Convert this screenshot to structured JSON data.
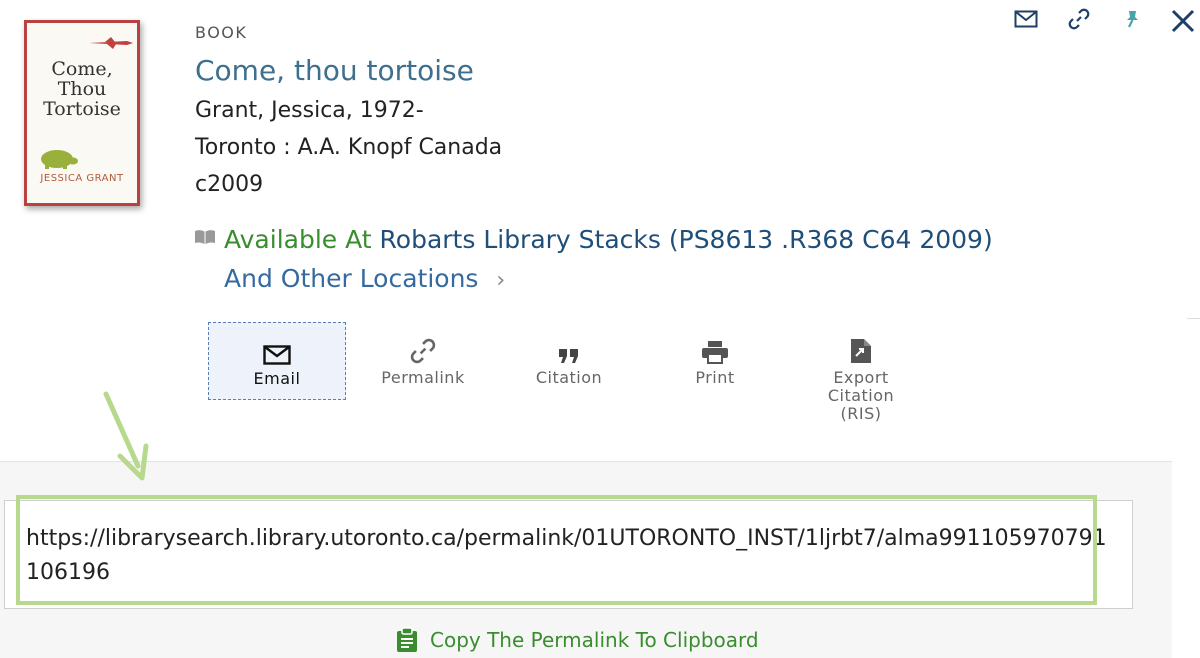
{
  "record": {
    "type": "BOOK",
    "title": "Come, thou tortoise",
    "author": "Grant, Jessica, 1972-",
    "publisher": "Toronto : A.A. Knopf Canada",
    "date": "c2009"
  },
  "cover": {
    "line1": "Come,",
    "line2": "Thou",
    "line3": "Tortoise",
    "author": "JESSICA GRANT"
  },
  "availability": {
    "status": "Available At",
    "location": "Robarts Library  Stacks (PS8613 .R368 C64 2009)",
    "other": "And Other Locations",
    "chevron": "›"
  },
  "actions": [
    {
      "label": "Email",
      "icon": "envelope-icon"
    },
    {
      "label": "Permalink",
      "icon": "link-icon"
    },
    {
      "label": "Citation",
      "icon": "quote-icon"
    },
    {
      "label": "Print",
      "icon": "printer-icon"
    },
    {
      "label": "Export Citation (RIS)",
      "icon": "export-file-icon"
    }
  ],
  "export_lines": [
    "Export",
    "Citation",
    "(RIS)"
  ],
  "permalink": {
    "url": "https://librarysearch.library.utoronto.ca/permalink/01UTORONTO_INST/1ljrbt7/alma991105970791106196",
    "copy_label": "Copy The Permalink To Clipboard"
  },
  "colors": {
    "title": "#3f6f8e",
    "available": "#3a8d2f",
    "location": "#1f4e79",
    "highlight": "#b7d98c",
    "pin": "#4aa3a8"
  }
}
